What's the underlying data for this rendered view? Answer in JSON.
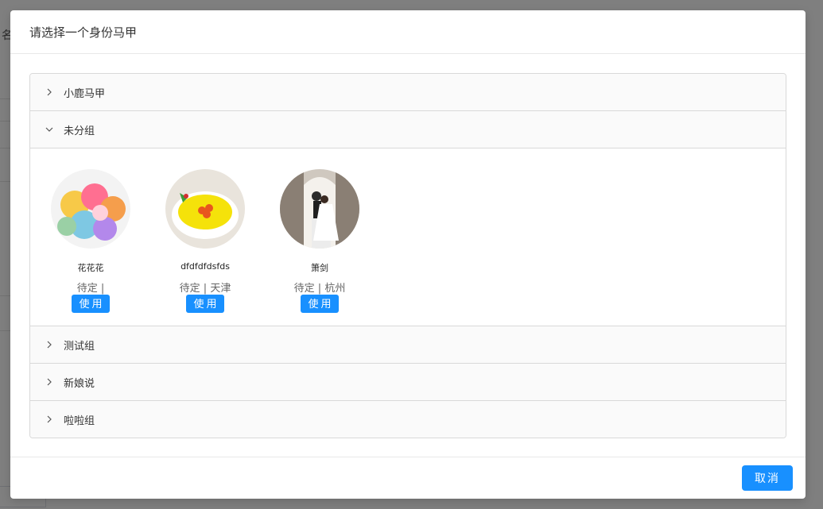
{
  "modal": {
    "title": "请选择一个身份马甲",
    "cancel_label": "取消"
  },
  "background": {
    "partial_text": "名"
  },
  "groups": [
    {
      "label": "小鹿马甲",
      "expanded": false
    },
    {
      "label": "未分组",
      "expanded": true,
      "identities": [
        {
          "name": "花花花",
          "meta": "待定 |",
          "action": "使用",
          "avatar": "colorful-heart-candies"
        },
        {
          "name": "dfdfdfdsfds",
          "meta": "待定 | 天津",
          "action": "使用",
          "avatar": "egg-custard-bowl"
        },
        {
          "name": "箫剑",
          "meta": "待定 | 杭州",
          "action": "使用",
          "avatar": "wedding-couple-photo"
        }
      ]
    },
    {
      "label": "测试组",
      "expanded": false
    },
    {
      "label": "新娘说",
      "expanded": false
    },
    {
      "label": "啦啦组",
      "expanded": false
    }
  ],
  "colors": {
    "primary": "#1890ff",
    "panel_header_bg": "#fafafa",
    "border": "#d9d9d9"
  }
}
